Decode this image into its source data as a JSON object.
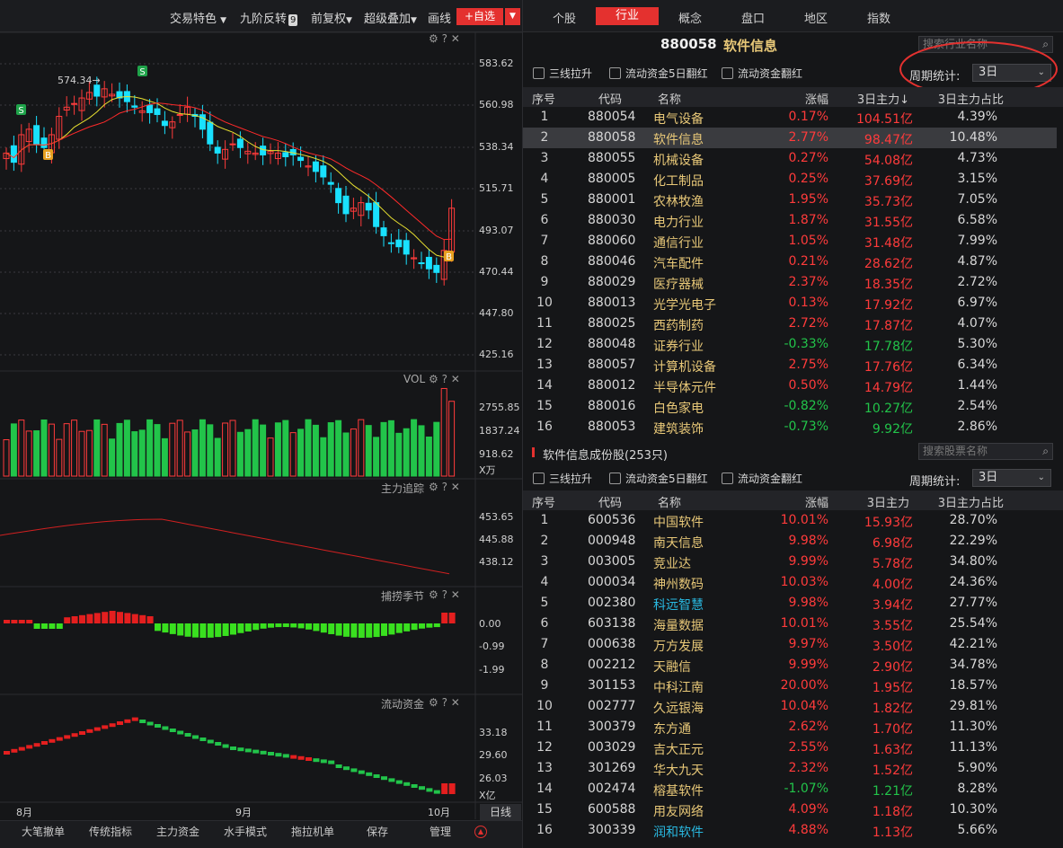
{
  "toolbar": {
    "special": "交易特色",
    "nine_reversal": "九阶反转",
    "nine_badge": "9",
    "adjust": "前复权",
    "overlay": "超级叠加",
    "draw": "画线",
    "add_watch": "+自选"
  },
  "chart": {
    "price_axis": [
      "583.62",
      "560.98",
      "538.34",
      "515.71",
      "493.07",
      "470.44",
      "447.80",
      "425.16"
    ],
    "high_label": "574.34",
    "vol_label": "VOL",
    "vol_axis": [
      "2755.85",
      "1837.24",
      "918.62",
      "X万"
    ],
    "main_trace_label": "主力追踪",
    "main_trace_axis": [
      "453.65",
      "445.88",
      "438.12"
    ],
    "season_label": "捕捞季节",
    "season_axis": [
      "0.00",
      "-0.99",
      "-1.99"
    ],
    "flow_label": "流动资金",
    "flow_axis": [
      "33.18",
      "29.60",
      "26.03",
      "X亿"
    ],
    "months": [
      "8月",
      "9月",
      "10月"
    ],
    "period_button": "日线",
    "signal_s": "S",
    "signal_b": "B",
    "colors": {
      "up": "#ff3b3b",
      "down": "#19e1ff",
      "ma_yellow": "#e8e030",
      "ma_red": "#ff2a2a",
      "vol_green": "#22c44a"
    }
  },
  "bottom_tabs": [
    "大笔撤单",
    "传统指标",
    "主力资金",
    "水手模式",
    "拖拉机单",
    "保存",
    "管理"
  ],
  "right": {
    "tabs": [
      "个股",
      "行业",
      "概念",
      "盘口",
      "地区",
      "指数"
    ],
    "active_tab": "行业",
    "code": "880058",
    "name": "软件信息",
    "search_industry": "搜索行业名称",
    "search_stock": "搜索股票名称",
    "filters": [
      "三线拉升",
      "流动资金5日翻红",
      "流动资金翻红"
    ],
    "period_label": "周期统计:",
    "period_value": "3日",
    "industry_headers": [
      "序号",
      "代码",
      "名称",
      "涨幅",
      "3日主力↓",
      "3日主力占比"
    ],
    "industry_rows": [
      [
        "1",
        "880054",
        "电气设备",
        "0.17%",
        "104.51亿",
        "4.39%"
      ],
      [
        "2",
        "880058",
        "软件信息",
        "2.77%",
        "98.47亿",
        "10.48%"
      ],
      [
        "3",
        "880055",
        "机械设备",
        "0.27%",
        "54.08亿",
        "4.73%"
      ],
      [
        "4",
        "880005",
        "化工制品",
        "0.25%",
        "37.69亿",
        "3.15%"
      ],
      [
        "5",
        "880001",
        "农林牧渔",
        "1.95%",
        "35.73亿",
        "7.05%"
      ],
      [
        "6",
        "880030",
        "电力行业",
        "1.87%",
        "31.55亿",
        "6.58%"
      ],
      [
        "7",
        "880060",
        "通信行业",
        "1.05%",
        "31.48亿",
        "7.99%"
      ],
      [
        "8",
        "880046",
        "汽车配件",
        "0.21%",
        "28.62亿",
        "4.87%"
      ],
      [
        "9",
        "880029",
        "医疗器械",
        "2.37%",
        "18.35亿",
        "2.72%"
      ],
      [
        "10",
        "880013",
        "光学光电子",
        "0.13%",
        "17.92亿",
        "6.97%"
      ],
      [
        "11",
        "880025",
        "西药制药",
        "2.72%",
        "17.87亿",
        "4.07%"
      ],
      [
        "12",
        "880048",
        "证券行业",
        "-0.33%",
        "17.78亿",
        "5.30%"
      ],
      [
        "13",
        "880057",
        "计算机设备",
        "2.75%",
        "17.76亿",
        "6.34%"
      ],
      [
        "14",
        "880012",
        "半导体元件",
        "0.50%",
        "14.79亿",
        "1.44%"
      ],
      [
        "15",
        "880016",
        "白色家电",
        "-0.82%",
        "10.27亿",
        "2.54%"
      ],
      [
        "16",
        "880053",
        "建筑装饰",
        "-0.73%",
        "9.92亿",
        "2.86%"
      ]
    ],
    "components_title": "软件信息成份股(253只)",
    "stock_headers": [
      "序号",
      "代码",
      "名称",
      "涨幅",
      "3日主力",
      "3日主力占比"
    ],
    "stock_rows": [
      [
        "1",
        "600536",
        "中国软件",
        "10.01%",
        "15.93亿",
        "28.70%"
      ],
      [
        "2",
        "000948",
        "南天信息",
        "9.98%",
        "6.98亿",
        "22.29%"
      ],
      [
        "3",
        "003005",
        "竞业达",
        "9.99%",
        "5.78亿",
        "34.80%"
      ],
      [
        "4",
        "000034",
        "神州数码",
        "10.03%",
        "4.00亿",
        "24.36%"
      ],
      [
        "5",
        "002380",
        "科远智慧",
        "9.98%",
        "3.94亿",
        "27.77%"
      ],
      [
        "6",
        "603138",
        "海量数据",
        "10.01%",
        "3.55亿",
        "25.54%"
      ],
      [
        "7",
        "000638",
        "万方发展",
        "9.97%",
        "3.50亿",
        "42.21%"
      ],
      [
        "8",
        "002212",
        "天融信",
        "9.99%",
        "2.90亿",
        "34.78%"
      ],
      [
        "9",
        "301153",
        "中科江南",
        "20.00%",
        "1.95亿",
        "18.57%"
      ],
      [
        "10",
        "002777",
        "久远银海",
        "10.04%",
        "1.82亿",
        "29.81%"
      ],
      [
        "11",
        "300379",
        "东方通",
        "2.62%",
        "1.70亿",
        "11.30%"
      ],
      [
        "12",
        "003029",
        "吉大正元",
        "2.55%",
        "1.63亿",
        "11.13%"
      ],
      [
        "13",
        "301269",
        "华大九天",
        "2.32%",
        "1.52亿",
        "5.90%"
      ],
      [
        "14",
        "002474",
        "榕基软件",
        "-1.07%",
        "1.21亿",
        "8.28%"
      ],
      [
        "15",
        "600588",
        "用友网络",
        "4.09%",
        "1.18亿",
        "10.30%"
      ],
      [
        "16",
        "300339",
        "润和软件",
        "4.88%",
        "1.13亿",
        "5.66%"
      ]
    ]
  }
}
